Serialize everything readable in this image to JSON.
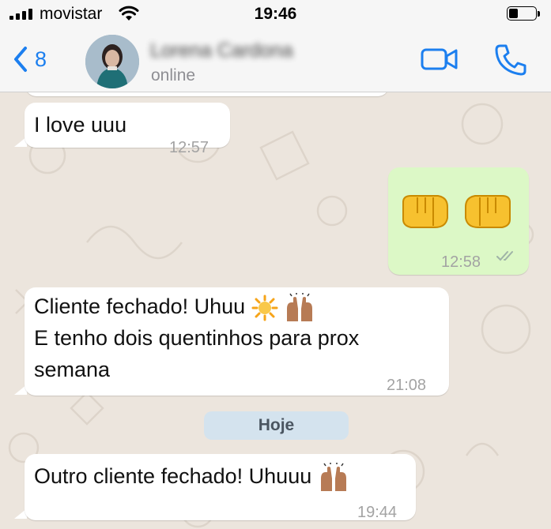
{
  "status_bar": {
    "carrier": "movistar",
    "time": "19:46",
    "battery_level": 0.35
  },
  "header": {
    "back_count": "8",
    "contact_name": "Lorena Cardona",
    "contact_status": "online",
    "icons": [
      "chevron-left-icon",
      "video-camera-icon",
      "phone-icon"
    ]
  },
  "messages": [
    {
      "direction": "in",
      "text": "I love uuu",
      "time": "12:57"
    },
    {
      "direction": "out",
      "emoji": [
        "fist-right-icon",
        "fist-left-icon"
      ],
      "time": "12:58",
      "status": "read-double-check"
    },
    {
      "direction": "in",
      "text_line1": "Cliente fechado! Uhuu",
      "text_line2": "E tenho dois quentinhos para prox",
      "text_line3": "semana",
      "emoji": [
        "sun-icon",
        "raising-hands-icon"
      ],
      "time": "21:08"
    },
    {
      "date_separator": "Hoje"
    },
    {
      "direction": "in",
      "text": "Outro cliente fechado! Uhuuu",
      "emoji": [
        "raising-hands-icon"
      ],
      "time": "19:44"
    }
  ],
  "colors": {
    "accent": "#1C7FEF",
    "outgoing_bubble": "#DCF8C6",
    "incoming_bubble": "#FFFFFF",
    "wallpaper": "#ECE5DD"
  }
}
